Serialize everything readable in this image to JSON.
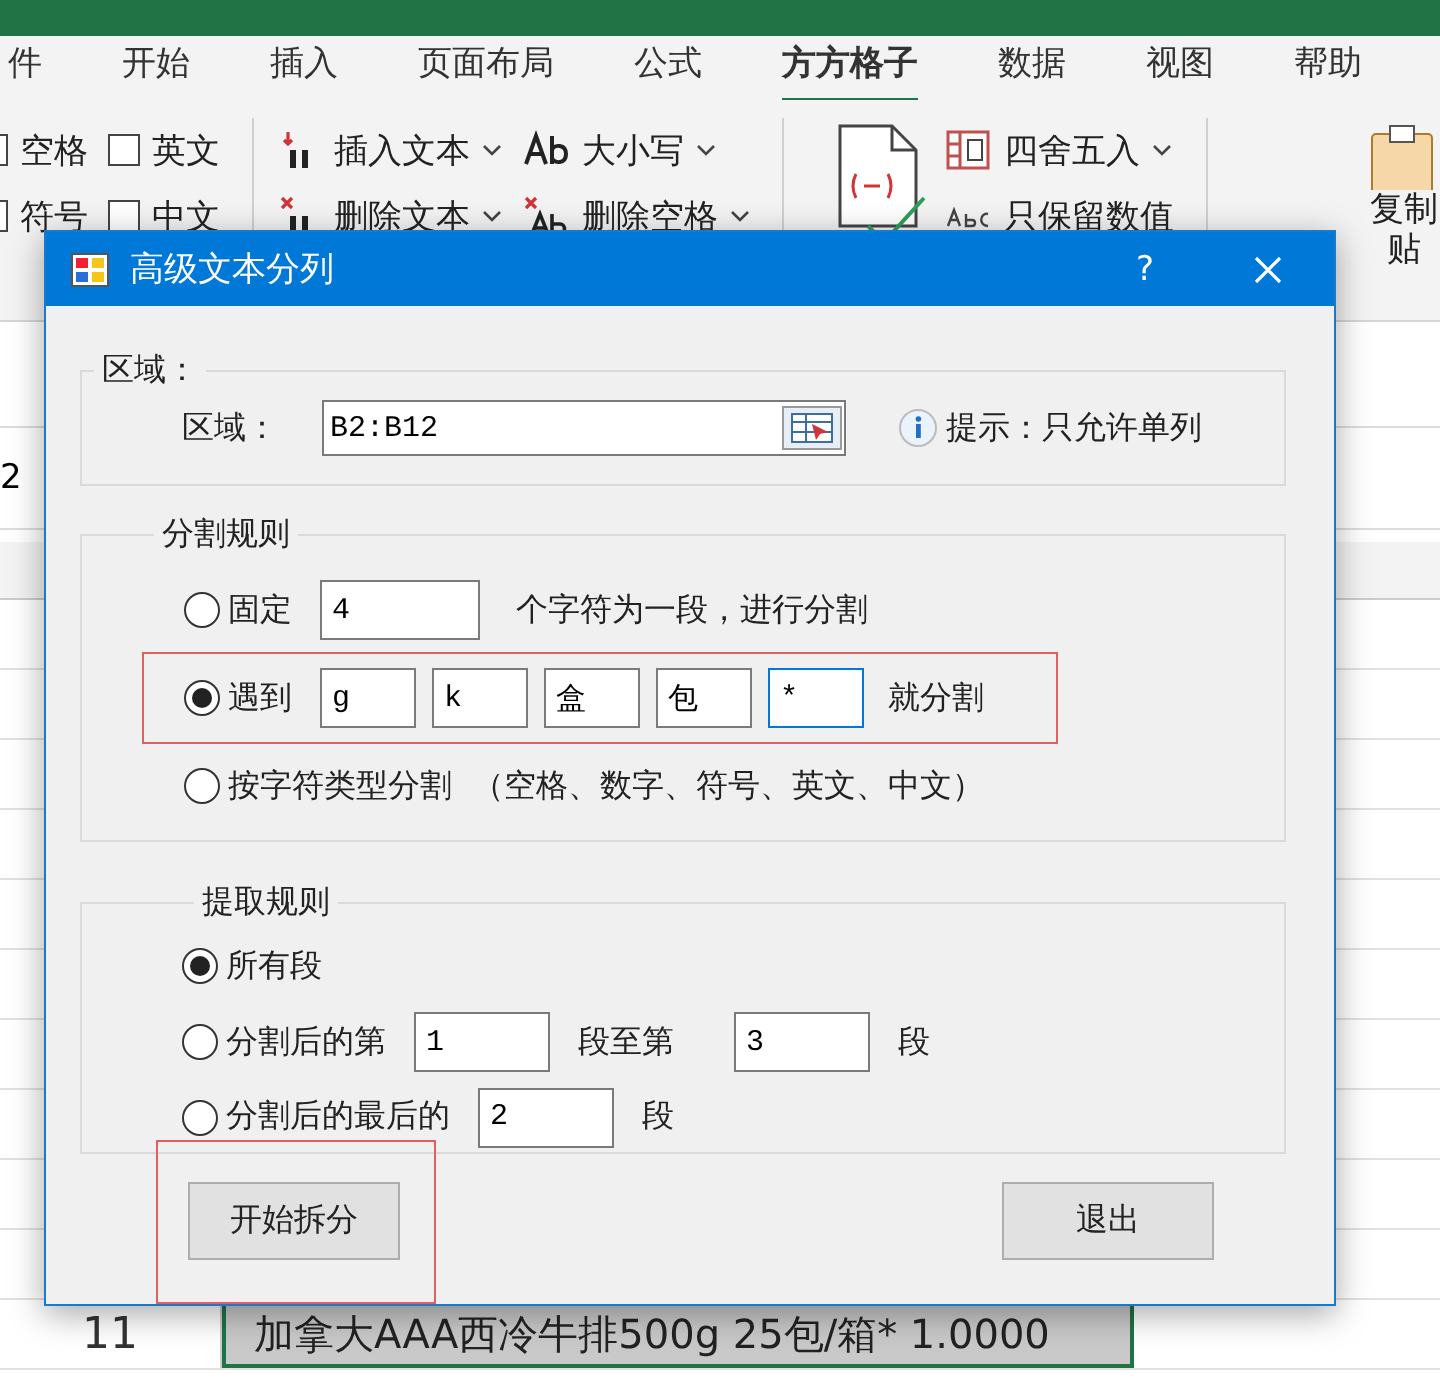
{
  "ribbon": {
    "tabs": [
      {
        "label": "件",
        "selected": false
      },
      {
        "label": "开始",
        "selected": false
      },
      {
        "label": "插入",
        "selected": false
      },
      {
        "label": "页面布局",
        "selected": false
      },
      {
        "label": "公式",
        "selected": false
      },
      {
        "label": "方方格子",
        "selected": true
      },
      {
        "label": "数据",
        "selected": false
      },
      {
        "label": "视图",
        "selected": false
      },
      {
        "label": "帮助",
        "selected": false
      }
    ],
    "columns": [
      {
        "kind": "stack",
        "items": [
          {
            "kind": "check",
            "label": "空格",
            "checked": false
          },
          {
            "kind": "check",
            "label": "符号",
            "checked": false
          }
        ]
      },
      {
        "kind": "stack",
        "items": [
          {
            "kind": "check",
            "label": "英文",
            "checked": false
          },
          {
            "kind": "check",
            "label": "中文",
            "checked": false
          }
        ]
      },
      {
        "kind": "stack",
        "items": [
          {
            "kind": "command",
            "label": "插入文本",
            "dropdown": true
          },
          {
            "kind": "command",
            "label": "删除文本",
            "dropdown": true
          }
        ]
      },
      {
        "kind": "stack",
        "items": [
          {
            "kind": "command",
            "label": "大小写",
            "dropdown": true
          },
          {
            "kind": "command",
            "label": "删除空格",
            "dropdown": true
          }
        ]
      },
      {
        "kind": "icon"
      },
      {
        "kind": "stack",
        "items": [
          {
            "kind": "command",
            "label": "四舍五入",
            "dropdown": true
          },
          {
            "kind": "command",
            "label": "只保留数值",
            "dropdown": false
          }
        ]
      },
      {
        "kind": "big",
        "lines": [
          "复制",
          "贴"
        ]
      }
    ]
  },
  "sheet": {
    "name_box": "2",
    "rows": [
      {
        "header": "11",
        "cell": "加拿大AAA西冷牛排500g 25包/箱* 1.0000",
        "selected": true
      }
    ]
  },
  "dialog": {
    "title": "高级文本分列",
    "help": "?",
    "area_group": {
      "legend": "区域：",
      "label": "区域：",
      "value": "B2:B12",
      "hint": "提示：只允许单列"
    },
    "split_group": {
      "legend": "分割规则",
      "options": [
        {
          "kind": "fixed",
          "label": "固定",
          "selected": false,
          "highlighted": false,
          "value": "4",
          "suffix": "个字符为一段，进行分割"
        },
        {
          "kind": "delimiters",
          "label": "遇到",
          "selected": true,
          "highlighted": true,
          "values": [
            {
              "text": "g",
              "focused": false
            },
            {
              "text": "k",
              "focused": false
            },
            {
              "text": "盒",
              "focused": false
            },
            {
              "text": "包",
              "focused": false
            },
            {
              "text": "*",
              "focused": true
            }
          ],
          "suffix": "就分割"
        },
        {
          "kind": "type",
          "label": "按字符类型分割",
          "selected": false,
          "highlighted": false,
          "note": "（空格、数字、符号、英文、中文）"
        }
      ]
    },
    "extract_group": {
      "legend": "提取规则",
      "options": [
        {
          "kind": "all",
          "label": "所有段",
          "selected": true
        },
        {
          "kind": "range",
          "label": "分割后的第",
          "selected": false,
          "from": "1",
          "middle": "段至第",
          "to": "3",
          "suffix": "段"
        },
        {
          "kind": "last",
          "label": "分割后的最后的",
          "selected": false,
          "value": "2",
          "suffix": "段"
        }
      ]
    },
    "buttons": [
      {
        "label": "开始拆分",
        "highlighted": true
      },
      {
        "label": "退出",
        "highlighted": false
      }
    ]
  }
}
